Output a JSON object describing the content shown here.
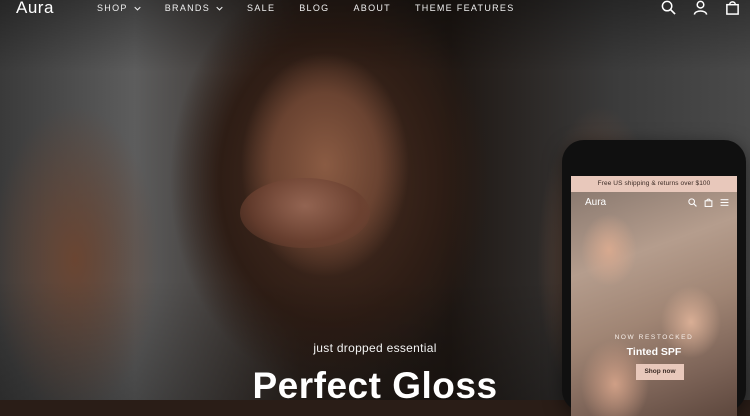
{
  "header": {
    "logo": "Aura",
    "nav": [
      {
        "label": "SHOP",
        "has_dropdown": true
      },
      {
        "label": "BRANDS",
        "has_dropdown": true
      },
      {
        "label": "SALE",
        "has_dropdown": false
      },
      {
        "label": "BLOG",
        "has_dropdown": false
      },
      {
        "label": "ABOUT",
        "has_dropdown": false
      },
      {
        "label": "THEME FEATURES",
        "has_dropdown": false
      }
    ],
    "icons": [
      "search-icon",
      "account-icon",
      "cart-icon"
    ]
  },
  "hero": {
    "eyebrow": "just dropped essential",
    "headline": "Perfect Gloss"
  },
  "phone": {
    "promo": "Free US shipping & returns over $100",
    "logo": "Aura",
    "icons": [
      "search-icon",
      "cart-icon",
      "menu-icon"
    ],
    "kicker": "NOW RESTOCKED",
    "title": "Tinted SPF",
    "cta": "Shop now"
  },
  "colors": {
    "accent_blush": "#e8c8bb",
    "text_light": "#ffffff",
    "phone_frame": "#101010"
  }
}
